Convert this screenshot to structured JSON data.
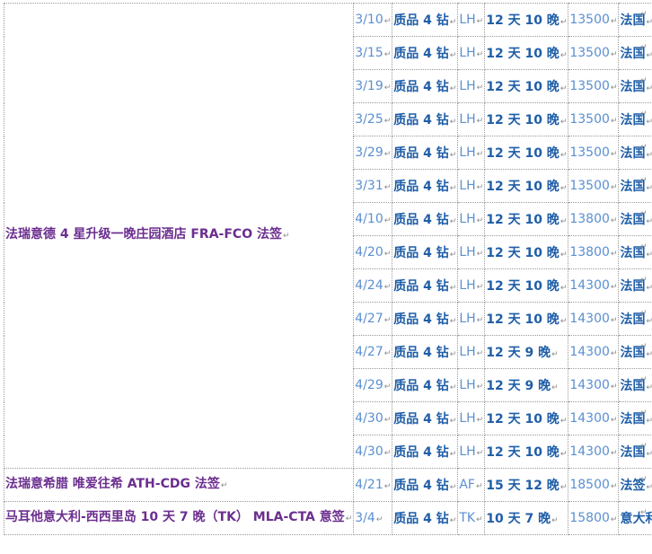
{
  "paragraph_mark": "↵",
  "groups": [
    {
      "name": "法瑞意德 4 星升级一晚庄园酒店 FRA-FCO 法签",
      "rows": [
        {
          "date": "3/10",
          "grade": "质品 4 钻",
          "airline": "LH",
          "duration": "12 天 10 晚",
          "price": "13500",
          "visa": "法国"
        },
        {
          "date": "3/15",
          "grade": "质品 4 钻",
          "airline": "LH",
          "duration": "12 天 10 晚",
          "price": "13500",
          "visa": "法国"
        },
        {
          "date": "3/19",
          "grade": "质品 4 钻",
          "airline": "LH",
          "duration": "12 天 10 晚",
          "price": "13500",
          "visa": "法国"
        },
        {
          "date": "3/25",
          "grade": "质品 4 钻",
          "airline": "LH",
          "duration": "12 天 10 晚",
          "price": "13500",
          "visa": "法国"
        },
        {
          "date": "3/29",
          "grade": "质品 4 钻",
          "airline": "LH",
          "duration": "12 天 10 晚",
          "price": "13500",
          "visa": "法国"
        },
        {
          "date": "3/31",
          "grade": "质品 4 钻",
          "airline": "LH",
          "duration": "12 天 10 晚",
          "price": "13500",
          "visa": "法国"
        },
        {
          "date": "4/10",
          "grade": "质品 4 钻",
          "airline": "LH",
          "duration": "12 天 10 晚",
          "price": "13800",
          "visa": "法国"
        },
        {
          "date": "4/20",
          "grade": "质品 4 钻",
          "airline": "LH",
          "duration": "12 天 10 晚",
          "price": "13800",
          "visa": "法国"
        },
        {
          "date": "4/24",
          "grade": "质品 4 钻",
          "airline": "LH",
          "duration": "12 天 10 晚",
          "price": "14300",
          "visa": "法国"
        },
        {
          "date": "4/27",
          "grade": "质品 4 钻",
          "airline": "LH",
          "duration": "12 天 10 晚",
          "price": "14300",
          "visa": "法国"
        },
        {
          "date": "4/27",
          "grade": "质品 4 钻",
          "airline": "LH",
          "duration": "12 天 9 晚",
          "price": "14300",
          "visa": "法国"
        },
        {
          "date": "4/29",
          "grade": "质品 4 钻",
          "airline": "LH",
          "duration": "12 天 9 晚",
          "price": "14300",
          "visa": "法国"
        },
        {
          "date": "4/30",
          "grade": "质品 4 钻",
          "airline": "LH",
          "duration": "12 天 10 晚",
          "price": "14300",
          "visa": "法国"
        },
        {
          "date": "4/30",
          "grade": "质品 4 钻",
          "airline": "LH",
          "duration": "12 天 10 晚",
          "price": "14300",
          "visa": "法国"
        }
      ]
    },
    {
      "name": "法瑞意希腊 唯爱往希 ATH-CDG 法签",
      "rows": [
        {
          "date": "4/21",
          "grade": "质品 4 钻",
          "airline": "AF",
          "duration": "15 天 12 晚",
          "price": "18500",
          "visa": "法签"
        }
      ]
    },
    {
      "name": "马耳他意大利-西西里岛 10 天 7 晚（TK） MLA-CTA 意签",
      "rows": [
        {
          "date": "3/4",
          "grade": "质品 4 钻",
          "airline": "TK",
          "duration": "10 天 7 晚",
          "price": "15800",
          "visa": "意大利"
        }
      ]
    }
  ]
}
